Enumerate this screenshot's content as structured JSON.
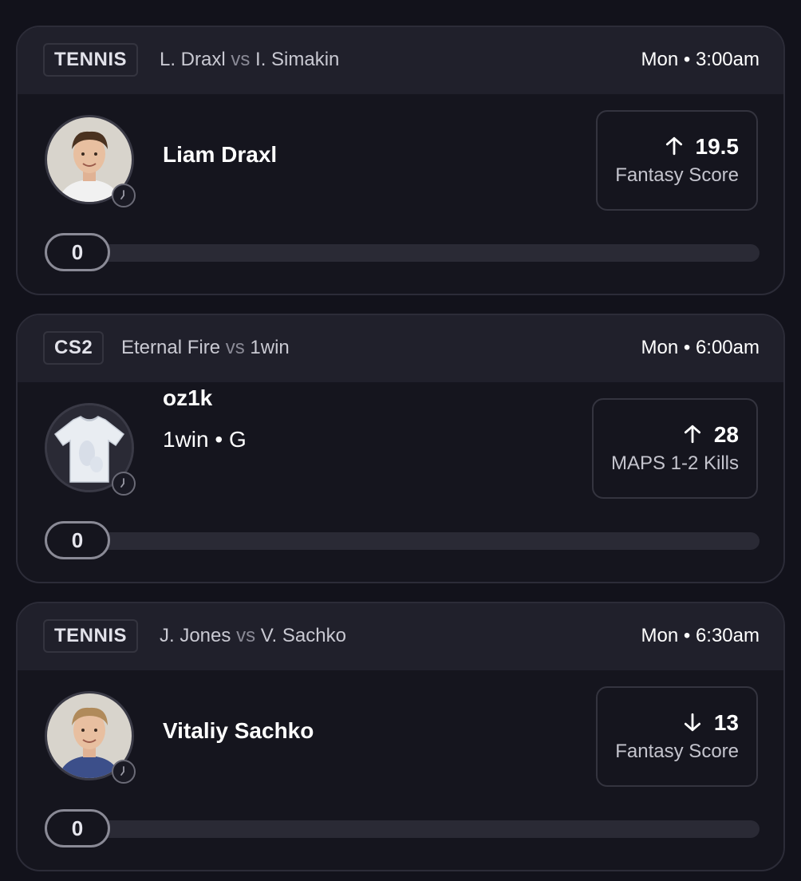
{
  "colors": {
    "background": "#12121b",
    "card_border": "#2c2c38",
    "header_bg": "#20202b",
    "track": "#2a2a35"
  },
  "cards": [
    {
      "sport": "TENNIS",
      "team_a": "L. Draxl",
      "vs": "vs",
      "team_b": "I. Simakin",
      "time": "Mon • 3:00am",
      "player": "Liam Draxl",
      "subtitle": "",
      "avatar": "player-photo",
      "direction": "up",
      "line": "19.5",
      "stat": "Fantasy Score",
      "progress_value": "0",
      "progress_fraction": 0
    },
    {
      "sport": "CS2",
      "team_a": "Eternal Fire",
      "vs": "vs",
      "team_b": "1win",
      "time": "Mon • 6:00am",
      "player": "oz1k",
      "subtitle": "1win • G",
      "avatar": "jersey",
      "direction": "up",
      "line": "28",
      "stat": "MAPS 1-2 Kills",
      "progress_value": "0",
      "progress_fraction": 0
    },
    {
      "sport": "TENNIS",
      "team_a": "J. Jones",
      "vs": "vs",
      "team_b": "V. Sachko",
      "time": "Mon • 6:30am",
      "player": "Vitaliy Sachko",
      "subtitle": "",
      "avatar": "player-photo",
      "direction": "down",
      "line": "13",
      "stat": "Fantasy Score",
      "progress_value": "0",
      "progress_fraction": 0
    }
  ]
}
